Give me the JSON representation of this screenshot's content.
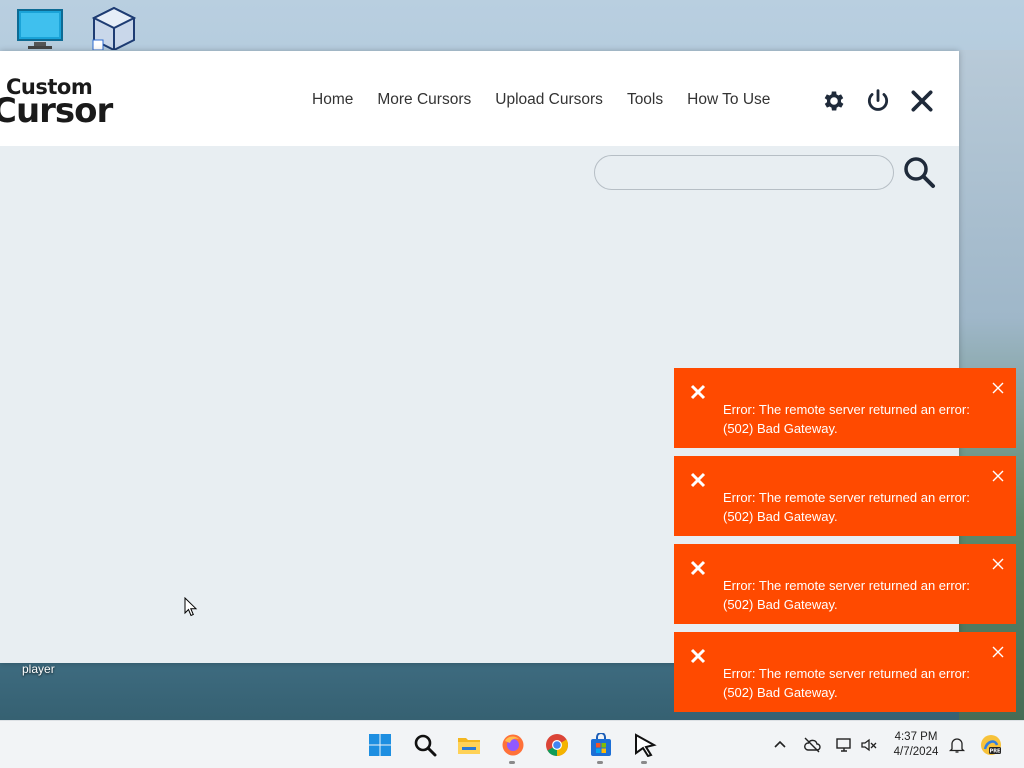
{
  "desktop": {
    "label": "player"
  },
  "app": {
    "logo": {
      "top": "Custom",
      "bottom": "Cursor"
    },
    "nav": [
      "Home",
      "More Cursors",
      "Upload Cursors",
      "Tools",
      "How To Use"
    ],
    "header_icons": [
      "gear-icon",
      "power-icon",
      "close-icon"
    ],
    "search": {
      "value": "",
      "placeholder": ""
    }
  },
  "toasts": [
    {
      "message": "Error: The remote server returned an error: (502) Bad Gateway."
    },
    {
      "message": "Error: The remote server returned an error: (502) Bad Gateway."
    },
    {
      "message": "Error: The remote server returned an error: (502) Bad Gateway."
    },
    {
      "message": "Error: The remote server returned an error: (502) Bad Gateway."
    }
  ],
  "colors": {
    "toast_bg": "#ff4a00",
    "header_bg": "#ffffff",
    "content_bg": "#e8eef2",
    "icon_dark": "#1f2a3a"
  },
  "taskbar": {
    "apps": [
      "windows-start-icon",
      "search-icon",
      "file-explorer-icon",
      "firefox-icon",
      "chrome-icon",
      "store-icon",
      "custom-cursor-app-icon"
    ],
    "tray": [
      "chevron-up-icon",
      "cloud-off-icon",
      "network-icon",
      "volume-muted-icon",
      "notification-bell-icon",
      "copilot-icon"
    ],
    "time": "4:37 PM",
    "date": "4/7/2024"
  }
}
